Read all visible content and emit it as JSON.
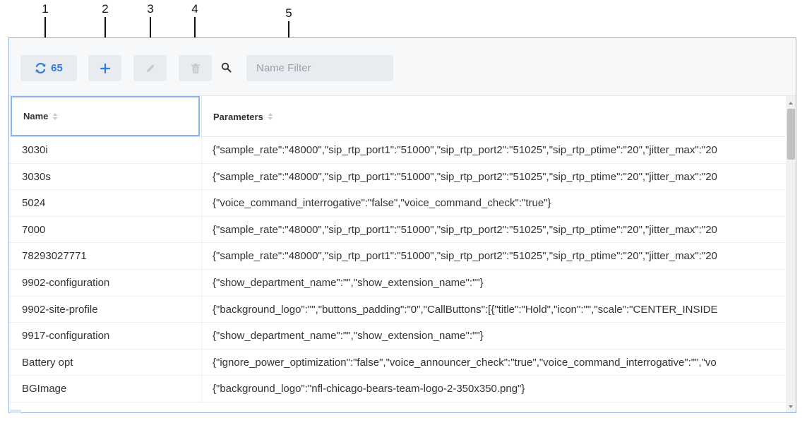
{
  "callouts": [
    "1",
    "2",
    "3",
    "4",
    "5"
  ],
  "toolbar": {
    "refresh_count": "65",
    "search_placeholder": "Name Filter",
    "accent_color": "#2f7de1"
  },
  "table": {
    "columns": [
      "Name",
      "Parameters"
    ],
    "rows": [
      {
        "name": "3030i",
        "params": "{\"sample_rate\":\"48000\",\"sip_rtp_port1\":\"51000\",\"sip_rtp_port2\":\"51025\",\"sip_rtp_ptime\":\"20\",\"jitter_max\":\"20"
      },
      {
        "name": "3030s",
        "params": "{\"sample_rate\":\"48000\",\"sip_rtp_port1\":\"51000\",\"sip_rtp_port2\":\"51025\",\"sip_rtp_ptime\":\"20\",\"jitter_max\":\"20"
      },
      {
        "name": "5024",
        "params": "{\"voice_command_interrogative\":\"false\",\"voice_command_check\":\"true\"}"
      },
      {
        "name": "7000",
        "params": "{\"sample_rate\":\"48000\",\"sip_rtp_port1\":\"51000\",\"sip_rtp_port2\":\"51025\",\"sip_rtp_ptime\":\"20\",\"jitter_max\":\"20"
      },
      {
        "name": "78293027771",
        "params": "{\"sample_rate\":\"48000\",\"sip_rtp_port1\":\"51000\",\"sip_rtp_port2\":\"51025\",\"sip_rtp_ptime\":\"20\",\"jitter_max\":\"20"
      },
      {
        "name": "9902-configuration",
        "params": "{\"show_department_name\":\"\",\"show_extension_name\":\"\"}"
      },
      {
        "name": "9902-site-profile",
        "params": "{\"background_logo\":\"\",\"buttons_padding\":\"0\",\"CallButtons\":[{\"title\":\"Hold\",\"icon\":\"\",\"scale\":\"CENTER_INSIDE"
      },
      {
        "name": "9917-configuration",
        "params": "{\"show_department_name\":\"\",\"show_extension_name\":\"\"}"
      },
      {
        "name": "Battery opt",
        "params": "{\"ignore_power_optimization\":\"false\",\"voice_announcer_check\":\"true\",\"voice_command_interrogative\":\"\",\"vo"
      },
      {
        "name": "BGImage",
        "params": "{\"background_logo\":\"nfl-chicago-bears-team-logo-2-350x350.png\"}"
      }
    ]
  }
}
